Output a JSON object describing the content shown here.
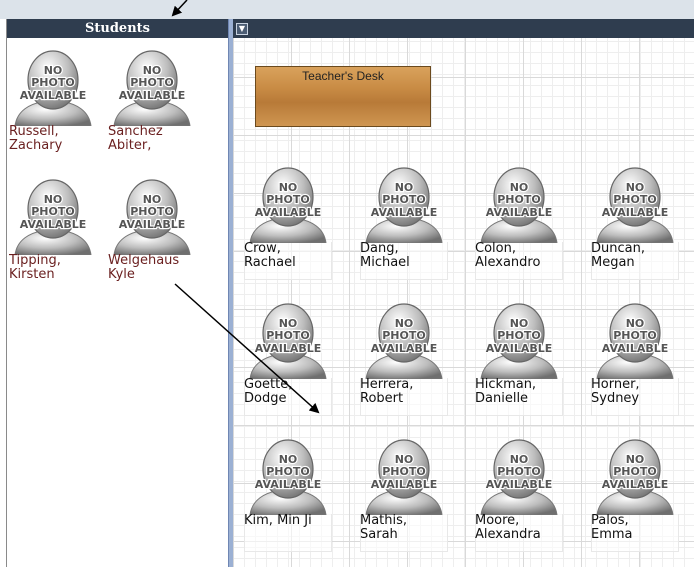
{
  "students_panel": {
    "title": "Students",
    "photo_placeholder": [
      "NO",
      "PHOTO",
      "AVAILABLE"
    ],
    "students": [
      {
        "name": "Russell,\nZachary"
      },
      {
        "name": "Sanchez\nAbiter,"
      },
      {
        "name": "Tipping,\nKirsten"
      },
      {
        "name": "Welgehaus\nKyle"
      }
    ]
  },
  "classroom": {
    "desk_label": "Teacher's Desk",
    "collapse_icon": "chevron-down-icon",
    "seats": [
      {
        "name": "Crow,\nRachael"
      },
      {
        "name": "Dang,\nMichael"
      },
      {
        "name": "Colon,\nAlexandro"
      },
      {
        "name": "Duncan,\nMegan"
      },
      {
        "name": "Goette,\nDodge"
      },
      {
        "name": "Herrera,\nRobert"
      },
      {
        "name": "Hickman,\nDanielle"
      },
      {
        "name": "Horner,\nSydney"
      },
      {
        "name": "Kim, Min Ji"
      },
      {
        "name": "Mathis,\nSarah"
      },
      {
        "name": "Moore,\nAlexandra"
      },
      {
        "name": "Palos,\nEmma"
      }
    ]
  },
  "colors": {
    "header_bg": "#2f3d4f",
    "divider": "#9bb0d3",
    "desk_wood": "#c98c45",
    "student_name": "#6a1f1f"
  }
}
